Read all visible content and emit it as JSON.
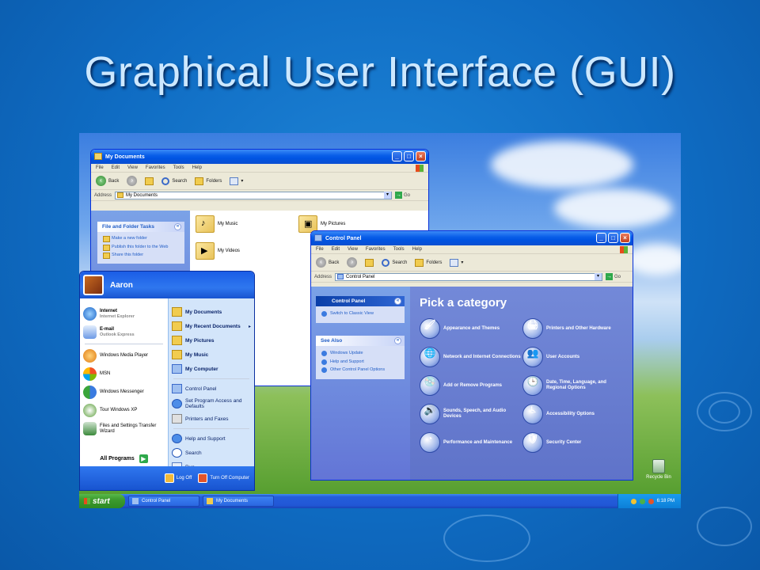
{
  "slide": {
    "title": "Graphical User Interface (GUI)"
  },
  "my_documents": {
    "title": "My Documents",
    "menu": [
      "File",
      "Edit",
      "View",
      "Favorites",
      "Tools",
      "Help"
    ],
    "toolbar": {
      "back": "Back",
      "search": "Search",
      "folders": "Folders"
    },
    "address_label": "Address",
    "address_value": "My Documents",
    "go": "Go",
    "task_panel": {
      "header": "File and Folder Tasks",
      "items": [
        "Make a new folder",
        "Publish this folder to the Web",
        "Share this folder"
      ]
    },
    "folders": [
      "My Music",
      "My Pictures",
      "My Videos"
    ]
  },
  "control_panel": {
    "title": "Control Panel",
    "menu": [
      "File",
      "Edit",
      "View",
      "Favorites",
      "Tools",
      "Help"
    ],
    "toolbar": {
      "back": "Back",
      "search": "Search",
      "folders": "Folders"
    },
    "address_label": "Address",
    "address_value": "Control Panel",
    "go": "Go",
    "left_header": "Control Panel",
    "switch_link": "Switch to Classic View",
    "see_also_header": "See Also",
    "see_also": [
      "Windows Update",
      "Help and Support",
      "Other Control Panel Options"
    ],
    "heading": "Pick a category",
    "categories": [
      "Appearance and Themes",
      "Printers and Other Hardware",
      "Network and Internet Connections",
      "User Accounts",
      "Add or Remove Programs",
      "Date, Time, Language, and Regional Options",
      "Sounds, Speech, and Audio Devices",
      "Accessibility Options",
      "Performance and Maintenance",
      "Security Center"
    ]
  },
  "start_menu": {
    "user": "Aaron",
    "pinned": [
      {
        "label": "Internet",
        "sub": "Internet Explorer"
      },
      {
        "label": "E-mail",
        "sub": "Outlook Express"
      }
    ],
    "recent": [
      "Windows Media Player",
      "MSN",
      "Windows Messenger",
      "Tour Windows XP",
      "Files and Settings Transfer Wizard"
    ],
    "all_programs": "All Programs",
    "right_bold": [
      "My Documents",
      "My Recent Documents",
      "My Pictures",
      "My Music",
      "My Computer"
    ],
    "right_items": [
      "Control Panel",
      "Set Program Access and Defaults",
      "Printers and Faxes"
    ],
    "right_bottom": [
      "Help and Support",
      "Search",
      "Run..."
    ],
    "log_off": "Log Off",
    "turn_off": "Turn Off Computer"
  },
  "desktop": {
    "recycle_bin": "Recycle Bin"
  },
  "taskbar": {
    "start": "start",
    "items": [
      "Control Panel",
      "My Documents"
    ],
    "clock": "6:18 PM"
  }
}
